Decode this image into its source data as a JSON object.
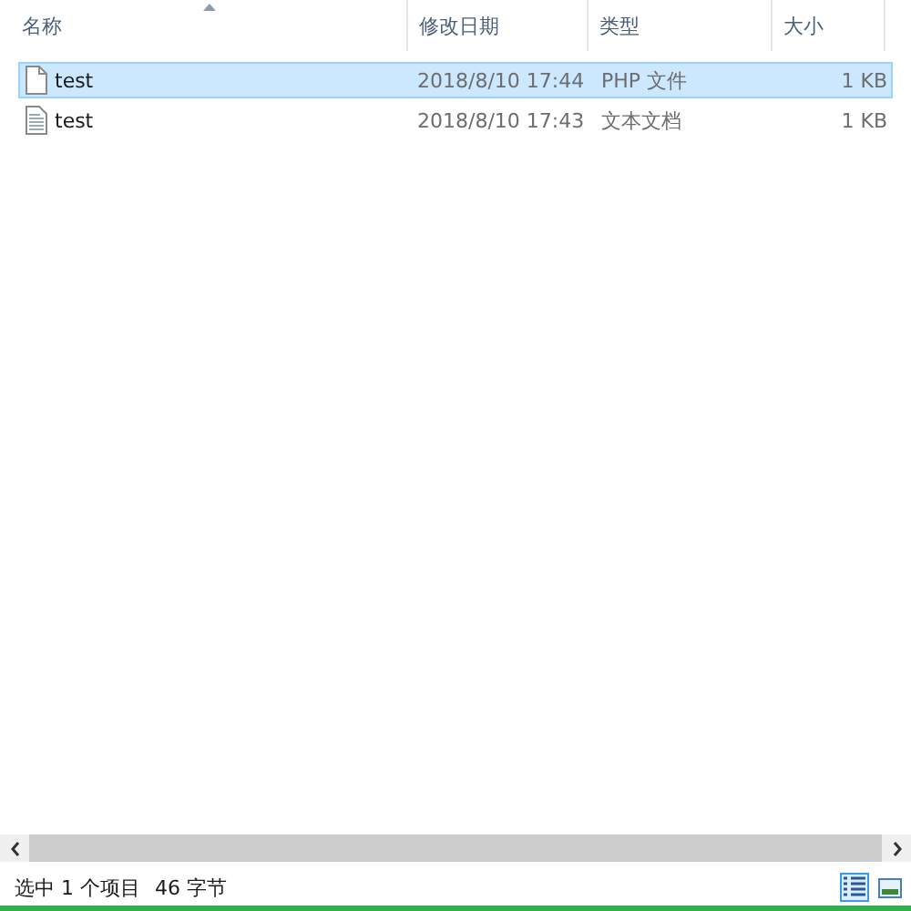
{
  "columns": [
    {
      "label": "名称",
      "sorted": true
    },
    {
      "label": "修改日期",
      "sorted": false
    },
    {
      "label": "类型",
      "sorted": false
    },
    {
      "label": "大小",
      "sorted": false
    }
  ],
  "rows": [
    {
      "kind": "blank",
      "name": "test",
      "modified": "2018/8/10 17:44",
      "type": "PHP 文件",
      "size": "1 KB",
      "selected": true
    },
    {
      "kind": "text",
      "name": "test",
      "modified": "2018/8/10 17:43",
      "type": "文本文档",
      "size": "1 KB",
      "selected": false
    }
  ],
  "status_bar": {
    "selection": "选中 1 个项目",
    "size": "46 字节"
  },
  "view_buttons": [
    {
      "kind": "details",
      "selected": true
    },
    {
      "kind": "large-icons",
      "selected": false
    }
  ]
}
